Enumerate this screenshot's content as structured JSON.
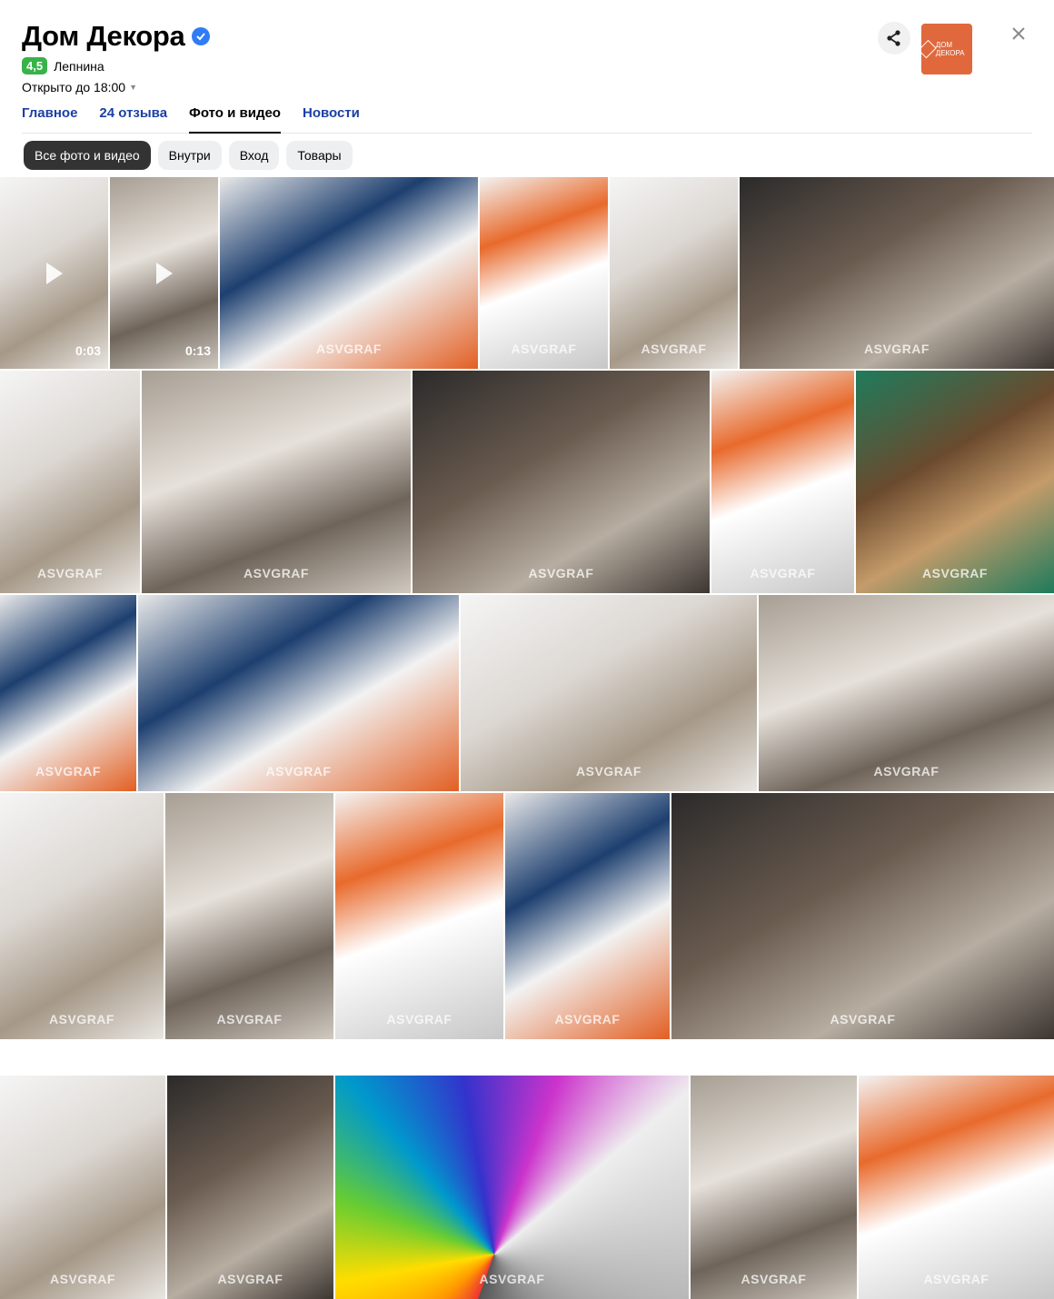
{
  "header": {
    "title": "Дом Декора",
    "rating": "4,5",
    "category": "Лепнина",
    "hours": "Открыто до 18:00",
    "logo_text": "ДОМ ДЕКОРА"
  },
  "tabs": [
    {
      "label": "Главное"
    },
    {
      "label": "24 отзыва"
    },
    {
      "label": "Фото и видео"
    },
    {
      "label": "Новости"
    }
  ],
  "chips": [
    {
      "label": "Все фото и видео"
    },
    {
      "label": "Внутри"
    },
    {
      "label": "Вход"
    },
    {
      "label": "Товары"
    }
  ],
  "gallery": {
    "watermark": "ASVGRAF",
    "videos": [
      {
        "duration": "0:03"
      },
      {
        "duration": "0:13"
      }
    ]
  },
  "colors": {
    "accent_link": "#1b3fa5",
    "rating_green": "#37b34a",
    "brand_orange": "#e0683c"
  },
  "icons": [
    "verified-icon",
    "share-icon",
    "close-icon",
    "play-icon"
  ]
}
